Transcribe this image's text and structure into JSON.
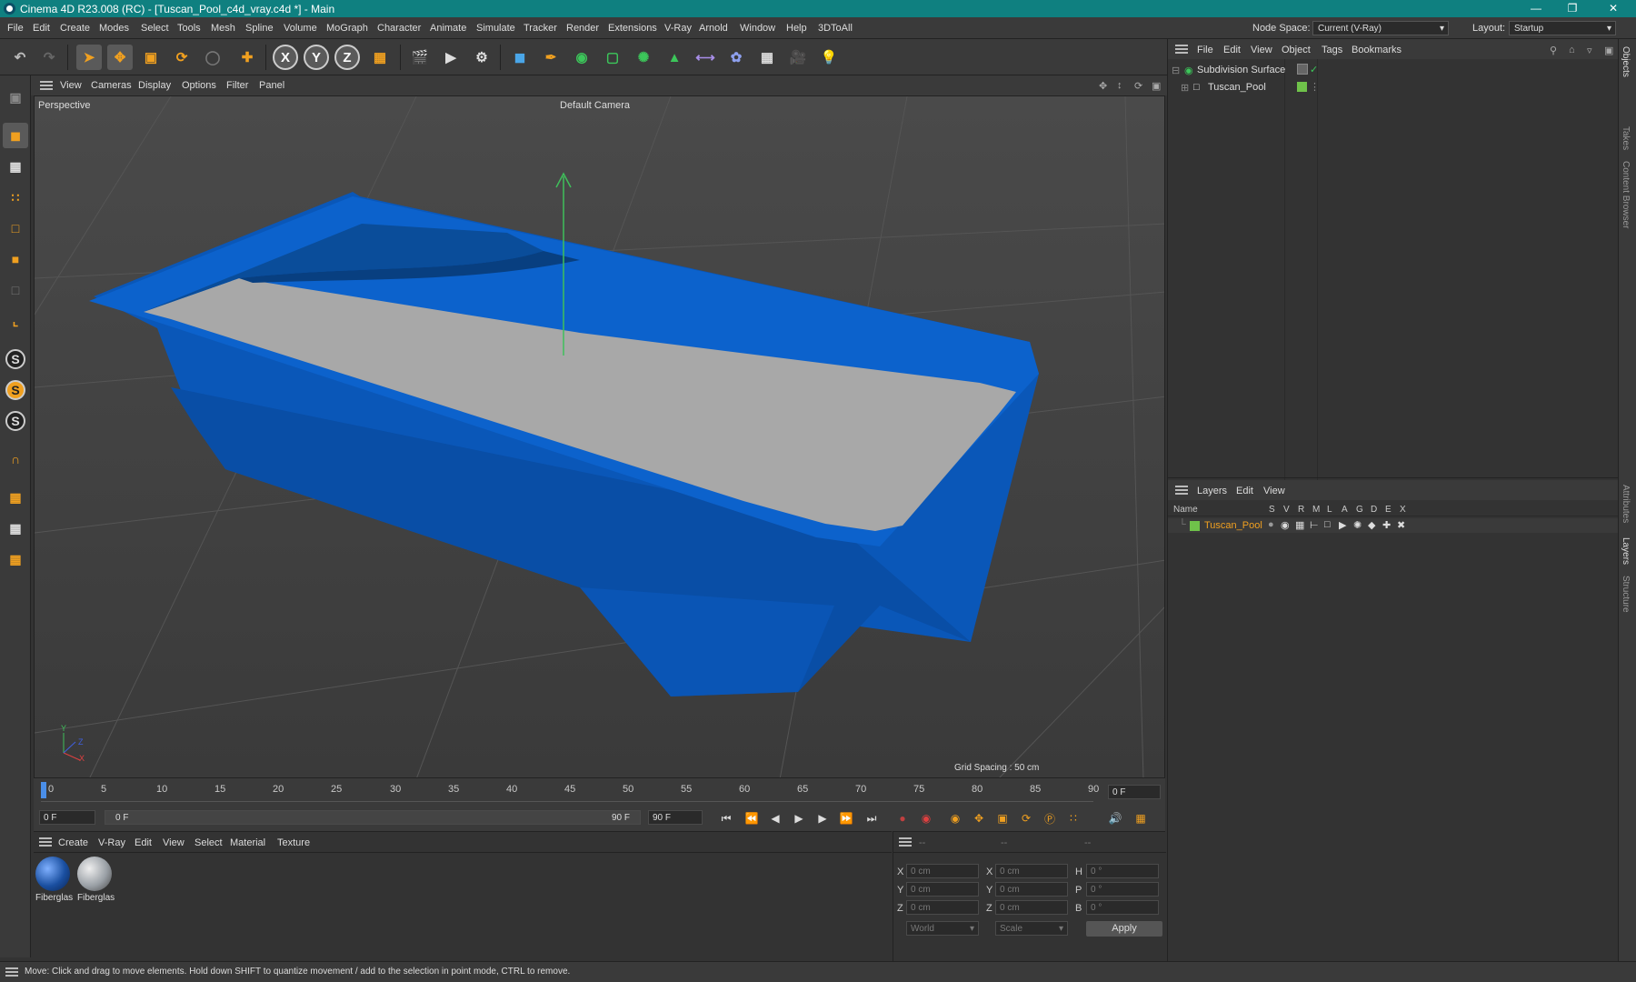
{
  "window": {
    "title": "Cinema 4D R23.008 (RC) - [Tuscan_Pool_c4d_vray.c4d *] - Main"
  },
  "menubar": {
    "items": [
      "File",
      "Edit",
      "Create",
      "Modes",
      "Select",
      "Tools",
      "Mesh",
      "Spline",
      "Volume",
      "MoGraph",
      "Character",
      "Animate",
      "Simulate",
      "Tracker",
      "Render",
      "Extensions",
      "V-Ray",
      "Arnold",
      "Window",
      "Help",
      "3DToAll"
    ],
    "node_space_label": "Node Space:",
    "node_space_value": "Current (V-Ray)",
    "layout_label": "Layout:",
    "layout_value": "Startup"
  },
  "toolbar": {
    "axis_x": "X",
    "axis_y": "Y",
    "axis_z": "Z"
  },
  "viewport_menu": {
    "items": [
      "View",
      "Cameras",
      "Display",
      "Options",
      "Filter",
      "Panel"
    ]
  },
  "viewport": {
    "view_name": "Perspective",
    "camera": "Default Camera",
    "grid_spacing": "Grid Spacing : 50 cm",
    "axis_x": "X",
    "axis_y": "Y",
    "axis_z": "Z"
  },
  "timeline": {
    "ticks": [
      "0",
      "5",
      "10",
      "15",
      "20",
      "25",
      "30",
      "35",
      "40",
      "45",
      "50",
      "55",
      "60",
      "65",
      "70",
      "75",
      "80",
      "85",
      "90"
    ],
    "end_frame": "0 F"
  },
  "transport": {
    "current_frame": "0 F",
    "range_start": "0 F",
    "range_end": "90 F",
    "max_frame": "90 F"
  },
  "materials": {
    "menu": [
      "Create",
      "V-Ray",
      "Edit",
      "View",
      "Select",
      "Material",
      "Texture"
    ],
    "items": [
      {
        "label": "Fiberglas",
        "color": "#1a4fa0"
      },
      {
        "label": "Fiberglas",
        "color": "#9aa0a6"
      }
    ]
  },
  "coordinates": {
    "headers": [
      "--",
      "--",
      "--"
    ],
    "rows": [
      {
        "a": "X",
        "av": "0 cm",
        "b": "X",
        "bv": "0 cm",
        "c": "H",
        "cv": "0 °"
      },
      {
        "a": "Y",
        "av": "0 cm",
        "b": "Y",
        "bv": "0 cm",
        "c": "P",
        "cv": "0 °"
      },
      {
        "a": "Z",
        "av": "0 cm",
        "b": "Z",
        "bv": "0 cm",
        "c": "B",
        "cv": "0 °"
      }
    ],
    "space": "World",
    "mode": "Scale",
    "apply": "Apply"
  },
  "objects_panel": {
    "menu": [
      "File",
      "Edit",
      "View",
      "Object",
      "Tags",
      "Bookmarks"
    ],
    "items": [
      {
        "name": "Subdivision Surface"
      },
      {
        "name": "Tuscan_Pool"
      }
    ]
  },
  "layers_panel": {
    "menu": [
      "Layers",
      "Edit",
      "View"
    ],
    "columns": [
      "Name",
      "S",
      "V",
      "R",
      "M",
      "L",
      "A",
      "G",
      "D",
      "E",
      "X"
    ],
    "layer": {
      "name": "Tuscan_Pool",
      "color": "#6fc24a"
    }
  },
  "side_tabs": [
    "Objects",
    "Takes",
    "Content Browser",
    "Attributes",
    "Layers",
    "Structure"
  ],
  "status": "Move: Click and drag to move elements. Hold down SHIFT to quantize movement / add to the selection in point mode, CTRL to remove.",
  "colors": {
    "accent": "#0f8080",
    "pool_blue": "#0b5cc0",
    "pool_floor": "#a8a8a8",
    "orange": "#f0a020"
  }
}
